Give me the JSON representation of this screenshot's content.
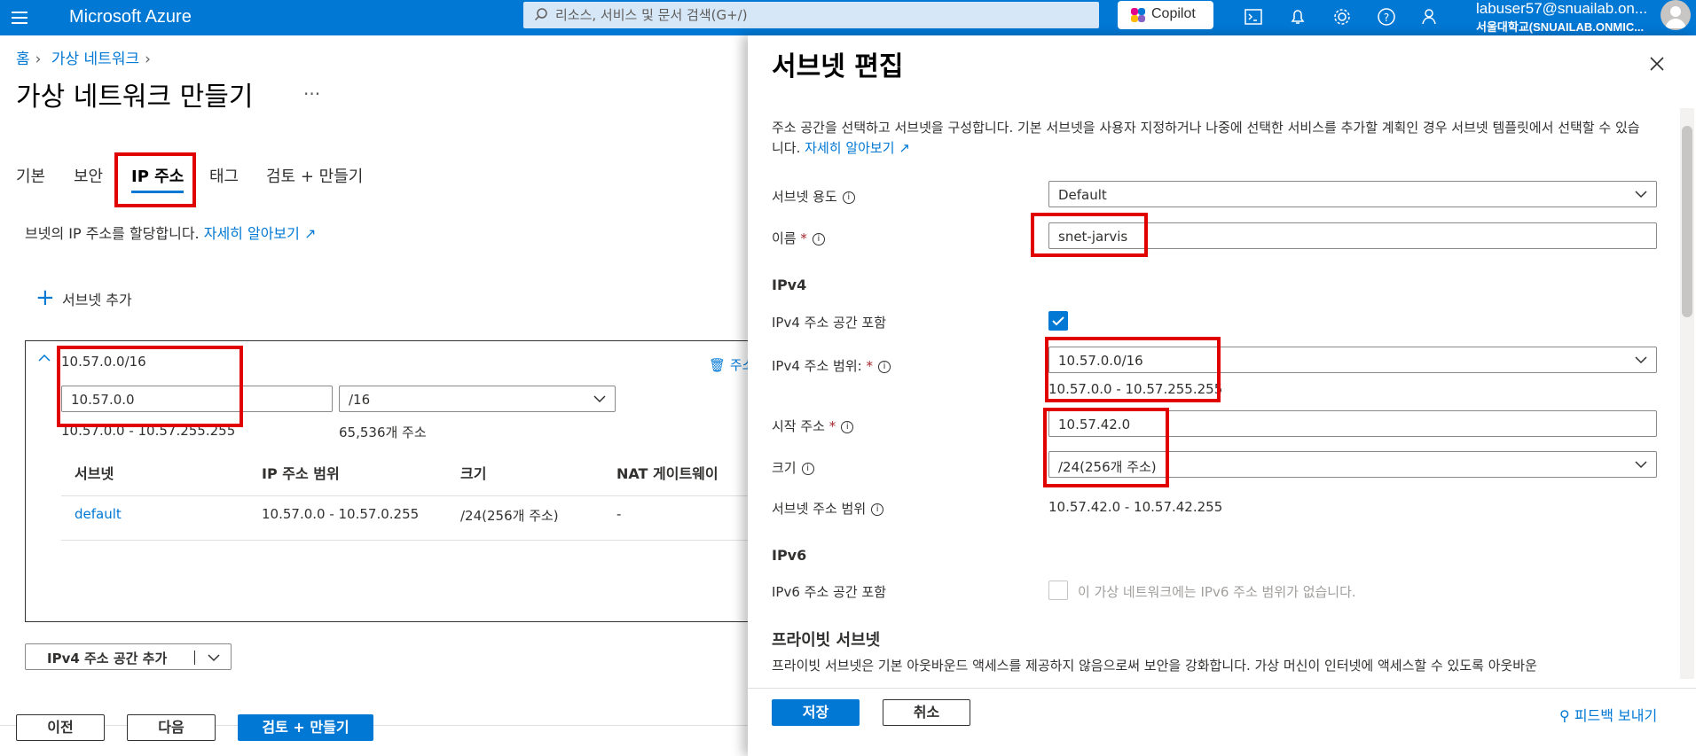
{
  "topbar": {
    "brand": "Microsoft Azure",
    "search_placeholder": "리소스, 서비스 및 문서 검색(G+/)",
    "copilot_label": "Copilot",
    "user_email": "labuser57@snuailab.on...",
    "user_org": "서울대학교(SNUAILAB.ONMIC..."
  },
  "breadcrumb": [
    "홈",
    "가상 네트워크"
  ],
  "page_title": "가상 네트워크 만들기",
  "more_label": "...",
  "tabs": [
    "기본",
    "보안",
    "IP 주소",
    "태그",
    "검토 + 만들기"
  ],
  "ip_tab": {
    "description": "브넷의 IP 주소를 할당합니다.",
    "learn_more": "자세히 알아보기",
    "add_subnet": "서브넷 추가",
    "address_space": {
      "cidr": "10.57.0.0/16",
      "start": "10.57.0.0",
      "prefix": "/16",
      "range": "10.57.0.0 - 10.57.255.255",
      "count": "65,536개 주소",
      "delete_label": "주소"
    },
    "columns": [
      "서브넷",
      "IP 주소 범위",
      "크기",
      "NAT 게이트웨이"
    ],
    "rows": [
      {
        "name": "default",
        "range": "10.57.0.0 - 10.57.0.255",
        "size": "/24(256개 주소)",
        "nat": "-"
      }
    ],
    "add_space_label": "IPv4 주소 공간 추가"
  },
  "footer": {
    "prev": "이전",
    "next": "다음",
    "review": "검토 + 만들기"
  },
  "blade": {
    "title": "서브넷 편집",
    "description": "주소 공간을 선택하고 서브넷을 구성합니다. 기본 서브넷을 사용자 지정하거나 나중에 선택한 서비스를 추가할 계획인 경우 서브넷 템플릿에서 선택할 수 있습니다.",
    "learn_more": "자세히 알아보기",
    "purpose_label": "서브넷 용도",
    "purpose_value": "Default",
    "name_label": "이름",
    "name_value": "snet-jarvis",
    "ipv4_section": "IPv4",
    "ipv4_include_label": "IPv4 주소 공간 포함",
    "ipv4_range_label": "IPv4 주소 범위:",
    "ipv4_range_value": "10.57.0.0/16",
    "ipv4_range_text": "10.57.0.0 - 10.57.255.255",
    "start_label": "시작 주소",
    "start_value": "10.57.42.0",
    "size_label": "크기",
    "size_value": "/24(256개 주소)",
    "subnet_range_label": "서브넷 주소 범위",
    "subnet_range_value": "10.57.42.0 - 10.57.42.255",
    "ipv6_section": "IPv6",
    "ipv6_include_label": "IPv6 주소 공간 포함",
    "ipv6_note": "이 가상 네트워크에는 IPv6 주소 범위가 없습니다.",
    "private_section": "프라이빗 서브넷",
    "private_desc": "프라이빗 서브넷은 기본 아웃바운드 액세스를 제공하지 않음으로써 보안을 강화합니다. 가상 머신이 인터넷에 액세스할 수 있도록 아웃바운",
    "save": "저장",
    "cancel": "취소",
    "feedback": "피드백 보내기"
  }
}
